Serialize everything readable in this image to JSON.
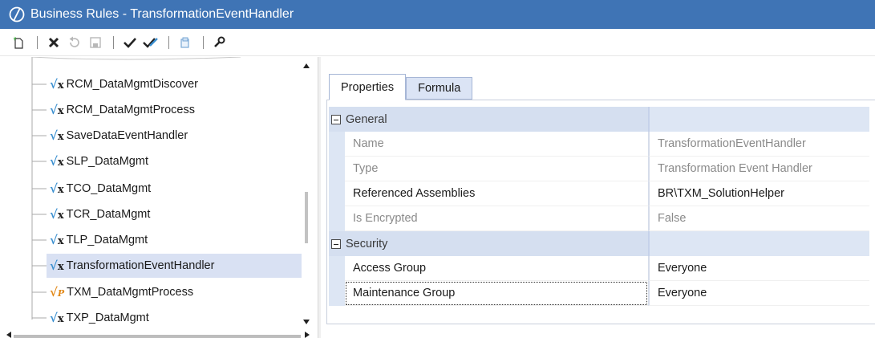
{
  "window": {
    "title": "Business Rules - TransformationEventHandler",
    "logo_icon": "onestream-logo-icon"
  },
  "toolbar": {
    "buttons": [
      {
        "name": "new-rule-button",
        "icon": "new-document-icon"
      },
      {
        "name": "delete-button",
        "icon": "close-x-icon"
      },
      {
        "name": "revert-button",
        "icon": "undo-icon"
      },
      {
        "name": "save-button",
        "icon": "save-icon"
      },
      {
        "name": "compile-button",
        "icon": "checkmark-icon"
      },
      {
        "name": "compile-all-button",
        "icon": "double-checkmark-icon"
      },
      {
        "name": "copy-button",
        "icon": "copy-icon"
      },
      {
        "name": "properties-button",
        "icon": "wrench-icon"
      }
    ]
  },
  "tree": {
    "items": [
      {
        "label": "RCM_DataMgmtDiscover",
        "icon": "formula-icon",
        "selected": false
      },
      {
        "label": "RCM_DataMgmtProcess",
        "icon": "formula-icon",
        "selected": false
      },
      {
        "label": "SaveDataEventHandler",
        "icon": "formula-icon",
        "selected": false
      },
      {
        "label": "SLP_DataMgmt",
        "icon": "formula-icon",
        "selected": false
      },
      {
        "label": "TCO_DataMgmt",
        "icon": "formula-icon",
        "selected": false
      },
      {
        "label": "TCR_DataMgmt",
        "icon": "formula-icon",
        "selected": false
      },
      {
        "label": "TLP_DataMgmt",
        "icon": "formula-icon",
        "selected": false
      },
      {
        "label": "TransformationEventHandler",
        "icon": "formula-icon",
        "selected": true
      },
      {
        "label": "TXM_DataMgmtProcess",
        "icon": "formula-orange-icon",
        "selected": false
      },
      {
        "label": "TXP_DataMgmt",
        "icon": "formula-icon",
        "selected": false
      }
    ]
  },
  "tabs": [
    {
      "label": "Properties",
      "active": true
    },
    {
      "label": "Formula",
      "active": false
    }
  ],
  "properties": {
    "general": {
      "label": "General",
      "rows": [
        {
          "name": "Name",
          "value": "TransformationEventHandler",
          "readonly": true
        },
        {
          "name": "Type",
          "value": "Transformation Event Handler",
          "readonly": true
        },
        {
          "name": "Referenced Assemblies",
          "value": "BR\\TXM_SolutionHelper",
          "readonly": false
        },
        {
          "name": "Is Encrypted",
          "value": "False",
          "readonly": true
        }
      ]
    },
    "security": {
      "label": "Security",
      "rows": [
        {
          "name": "Access Group",
          "value": "Everyone",
          "readonly": false
        },
        {
          "name": "Maintenance Group",
          "value": "Everyone",
          "readonly": false
        }
      ]
    }
  },
  "colors": {
    "titlebar": "#3f74b5",
    "selection": "#d9e1f3",
    "category": "#d5dff0"
  }
}
